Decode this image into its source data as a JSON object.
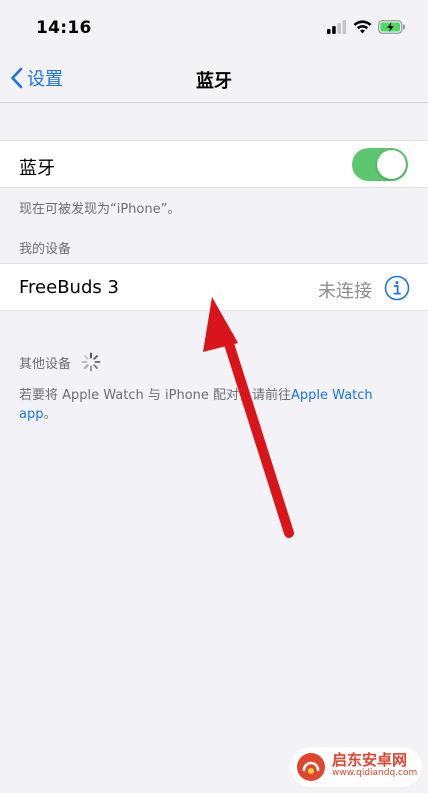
{
  "status_bar": {
    "time": "14:16",
    "icons": [
      "cellular-signal-icon",
      "wifi-icon",
      "battery-charging-icon"
    ]
  },
  "nav": {
    "back_label": "设置",
    "title": "蓝牙"
  },
  "bluetooth": {
    "label": "蓝牙",
    "enabled": true,
    "discoverable_note": "现在可被发现为“iPhone”。"
  },
  "my_devices": {
    "header": "我的设备",
    "items": [
      {
        "name": "FreeBuds 3",
        "status": "未连接"
      }
    ]
  },
  "other_devices": {
    "header": "其他设备",
    "note_prefix": "若要将 Apple Watch 与 iPhone 配对，请前往",
    "note_link": "Apple Watch app",
    "note_suffix": "。"
  },
  "colors": {
    "accent": "#1a73e8",
    "toggle_on": "#5cc76f",
    "background": "#f2f2f7",
    "annotation_arrow": "#d9141b"
  },
  "watermark": {
    "title": "启东安卓网",
    "url": "www.qidiandq.com"
  }
}
